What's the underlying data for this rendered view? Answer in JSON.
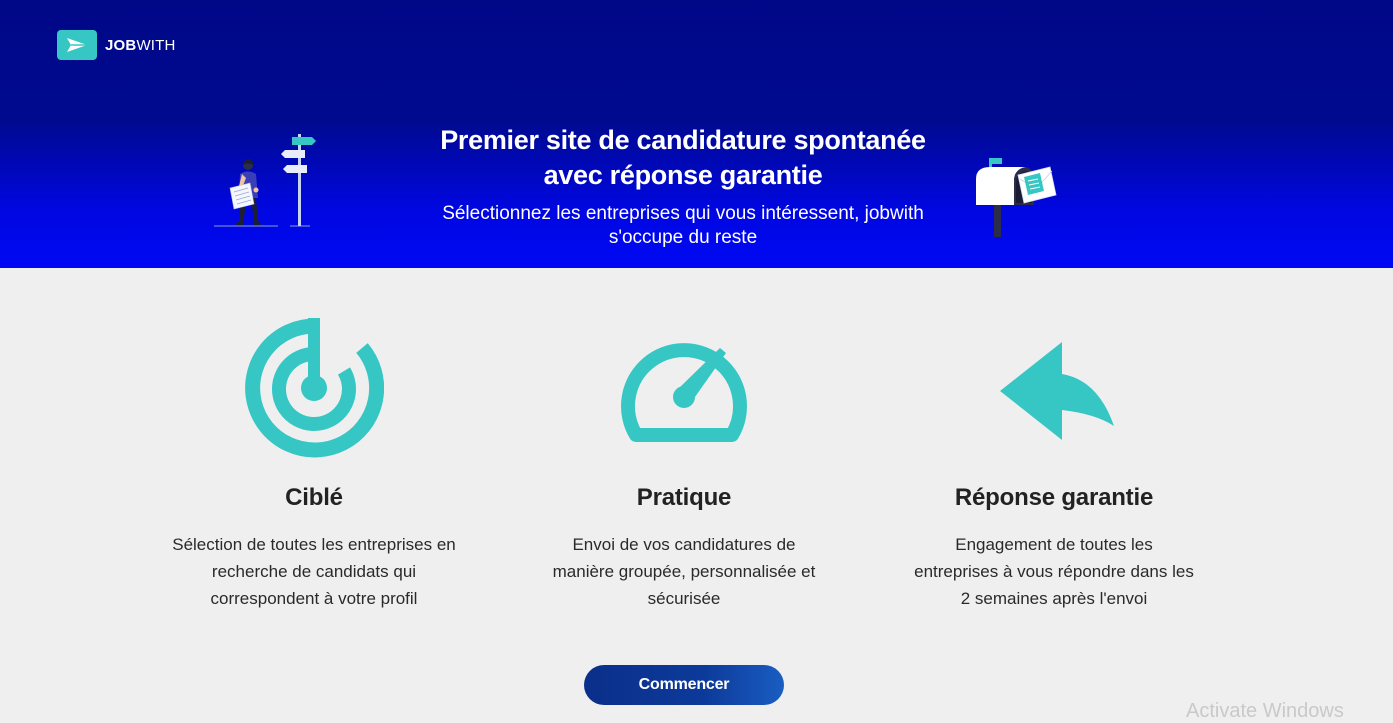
{
  "header": {
    "logo": {
      "bold": "JOB",
      "light": "WITH",
      "icon": "send-arrow-icon"
    }
  },
  "hero": {
    "title_line1": "Premier site de candidature spontanée",
    "title_line2": "avec réponse garantie",
    "subtitle_line1": "Sélectionnez les entreprises qui vous intéressent, jobwith",
    "subtitle_line2": "s'occupe du reste",
    "illustration_left": "person-with-signpost-illustration",
    "illustration_right": "mailbox-illustration"
  },
  "features": [
    {
      "icon": "target-icon",
      "title": "Ciblé",
      "desc_line1": "Sélection de toutes les entreprises en",
      "desc_line2": "recherche de candidats qui",
      "desc_line3": "correspondent à votre profil"
    },
    {
      "icon": "speedometer-icon",
      "title": "Pratique",
      "desc_line1": "Envoi de vos candidatures de",
      "desc_line2": "manière groupée, personnalisée et",
      "desc_line3": "sécurisée"
    },
    {
      "icon": "reply-arrow-icon",
      "title": "Réponse garantie",
      "desc_line1": "Engagement de toutes les",
      "desc_line2": "entreprises à vous répondre dans les",
      "desc_line3": "2 semaines après l'envoi"
    }
  ],
  "cta": {
    "label": "Commencer"
  },
  "watermark": "Activate Windows",
  "colors": {
    "accent": "#36c7c4",
    "hero_top": "#000888",
    "hero_bottom": "#0008f5",
    "cta": "#0c3a9a",
    "background": "#efefef"
  }
}
